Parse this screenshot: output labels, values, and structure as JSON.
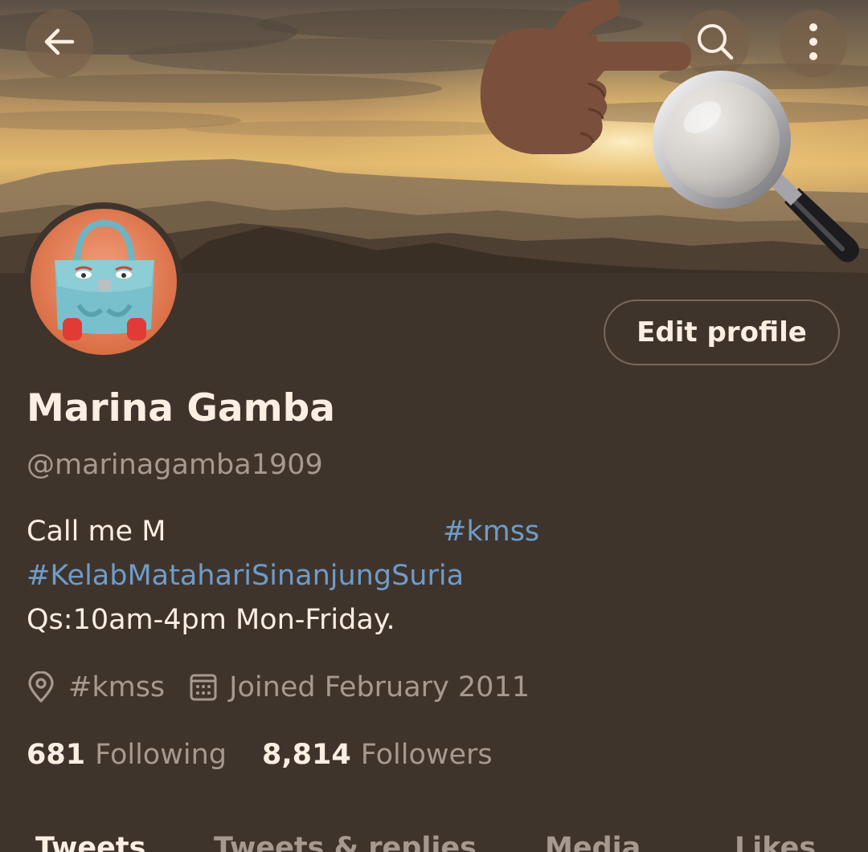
{
  "header": {
    "back_icon": "arrow-left-icon",
    "search_icon": "search-icon",
    "more_icon": "more-vertical-icon"
  },
  "decorations": {
    "pointing_hand": "pointing-hand-emoji",
    "magnifier": "magnifying-glass-emoji"
  },
  "profile": {
    "edit_label": "Edit profile",
    "name": "Marina Gamba",
    "handle": "@marinagamba1909",
    "bio": {
      "line1_text": "Call me M",
      "line1_tag": "#kmss",
      "line2_tag": "#KelabMatahariSinanjungSuria",
      "line3_text": "Qs:10am-4pm Mon-Friday."
    },
    "location": "#kmss",
    "joined": "Joined February 2011",
    "following_count": "681",
    "following_label": "Following",
    "followers_count": "8,814",
    "followers_label": "Followers"
  },
  "tabs": [
    {
      "label": "Tweets"
    },
    {
      "label": "Tweets & replies"
    },
    {
      "label": "Media"
    },
    {
      "label": "Likes"
    }
  ],
  "colors": {
    "background": "#3f342c",
    "primary_text": "#fbeee3",
    "secondary_text": "#a6998e",
    "link": "#6e9cc9",
    "border": "#77685c"
  }
}
